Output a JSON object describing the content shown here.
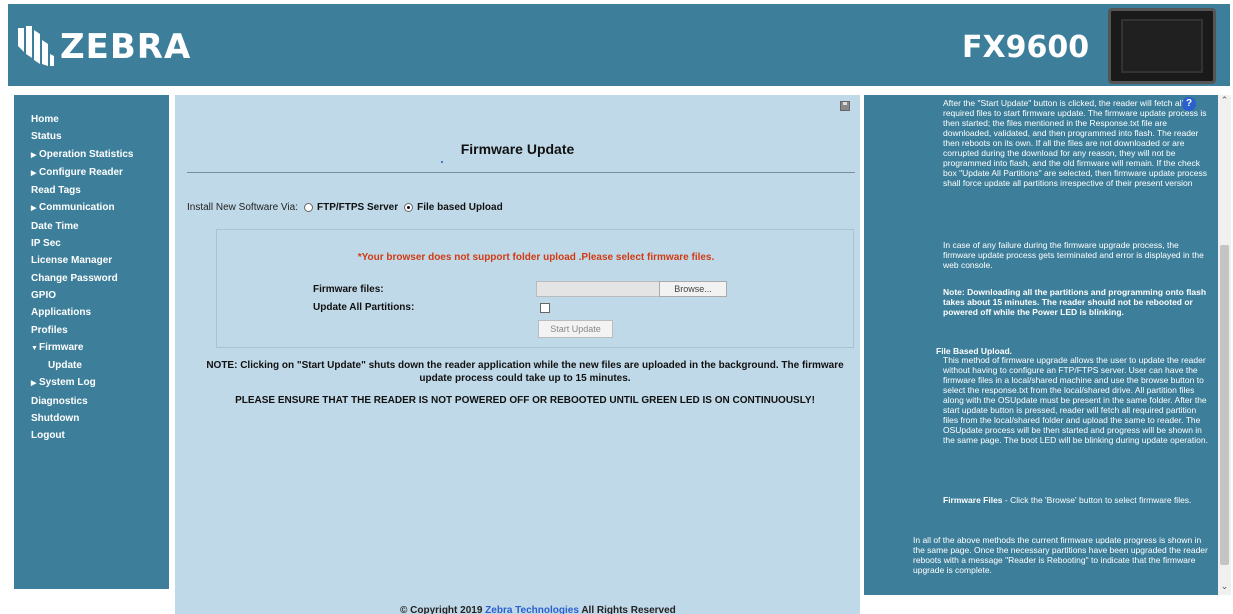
{
  "header": {
    "brand": "ZEBRA",
    "model": "FX9600"
  },
  "sidebar": {
    "items": [
      {
        "label": "Home",
        "arrow": ""
      },
      {
        "label": "Status",
        "arrow": ""
      },
      {
        "label": "Operation Statistics",
        "arrow": "▶"
      },
      {
        "label": "Configure Reader",
        "arrow": "▶"
      },
      {
        "label": "Read Tags",
        "arrow": ""
      },
      {
        "label": "Communication",
        "arrow": "▶"
      },
      {
        "label": "Date Time",
        "arrow": ""
      },
      {
        "label": "IP Sec",
        "arrow": ""
      },
      {
        "label": "License Manager",
        "arrow": ""
      },
      {
        "label": "Change Password",
        "arrow": ""
      },
      {
        "label": "GPIO",
        "arrow": ""
      },
      {
        "label": "Applications",
        "arrow": ""
      },
      {
        "label": "Profiles",
        "arrow": ""
      },
      {
        "label": "Firmware",
        "arrow": "▼"
      },
      {
        "label": "Update",
        "arrow": ""
      },
      {
        "label": "System Log",
        "arrow": "▶"
      },
      {
        "label": "Diagnostics",
        "arrow": ""
      },
      {
        "label": "Shutdown",
        "arrow": ""
      },
      {
        "label": "Logout",
        "arrow": ""
      }
    ]
  },
  "main": {
    "title": "Firmware Update",
    "install_label": "Install New Software Via:",
    "option_ftp": "FTP/FTPS Server",
    "option_file": "File based Upload",
    "selected_option": "File based Upload",
    "warning": "*Your browser does not support folder upload .Please select firmware files.",
    "firmware_files_label": "Firmware files:",
    "browse_label": "Browse...",
    "update_all_label": "Update All Partitions:",
    "start_update_label": "Start Update",
    "note": "NOTE: Clicking on \"Start Update\" shuts down the reader application while the new files are uploaded in the background. The firmware update process could take up to 15 minutes.",
    "ensure": "PLEASE ENSURE THAT THE READER IS NOT POWERED OFF OR REBOOTED UNTIL GREEN LED IS ON CONTINUOUSLY!"
  },
  "help": {
    "p1": "After the \"Start Update\" button is clicked, the reader will fetch all required files to start firmware update. The firmware update process is then started; the files mentioned in the Response.txt file are downloaded, validated, and then programmed into flash. The reader then reboots on its own. If all the files are not downloaded or are corrupted during the download for any reason, they will not be programmed into flash, and the old firmware will remain. If the check box \"Update All Partitions\" are selected, then firmware update process shall force update all partitions irrespective of their present version",
    "p2": "In case of any failure during the firmware upgrade process, the firmware update process gets terminated and error is displayed in the web console.",
    "p3": "Note: Downloading all the partitions and programming onto flash takes about 15 minutes. The reader should not be rebooted or powered off while the Power LED is blinking.",
    "h4": "File Based Upload.",
    "p4": "This method of firmware upgrade allows the user to update the reader without having to configure an FTP/FTPS server. User can have the firmware files in a local/shared machine and use the browse button to select the response.txt from the local/shared drive. All partition files along with the OSUpdate must be present in the same folder. After the start update button is pressed, reader will fetch all required partition files from the local/shared folder and upload the same to reader. The OSUpdate process will be then started and progress will be shown in the same page. The boot LED will be blinking during update operation.",
    "h5": "Firmware Files",
    "p5": " - Click the 'Browse' button to select firmware files.",
    "p6": "In all of the above methods the current firmware update progress is shown in the same page. Once the necessary partitions have been upgraded the reader reboots with a message \"Reader is Rebooting\" to indicate that the firmware upgrade is complete."
  },
  "footer": {
    "prefix": "© Copyright 2019 ",
    "link": "Zebra Technologies",
    "suffix": " All Rights Reserved"
  }
}
